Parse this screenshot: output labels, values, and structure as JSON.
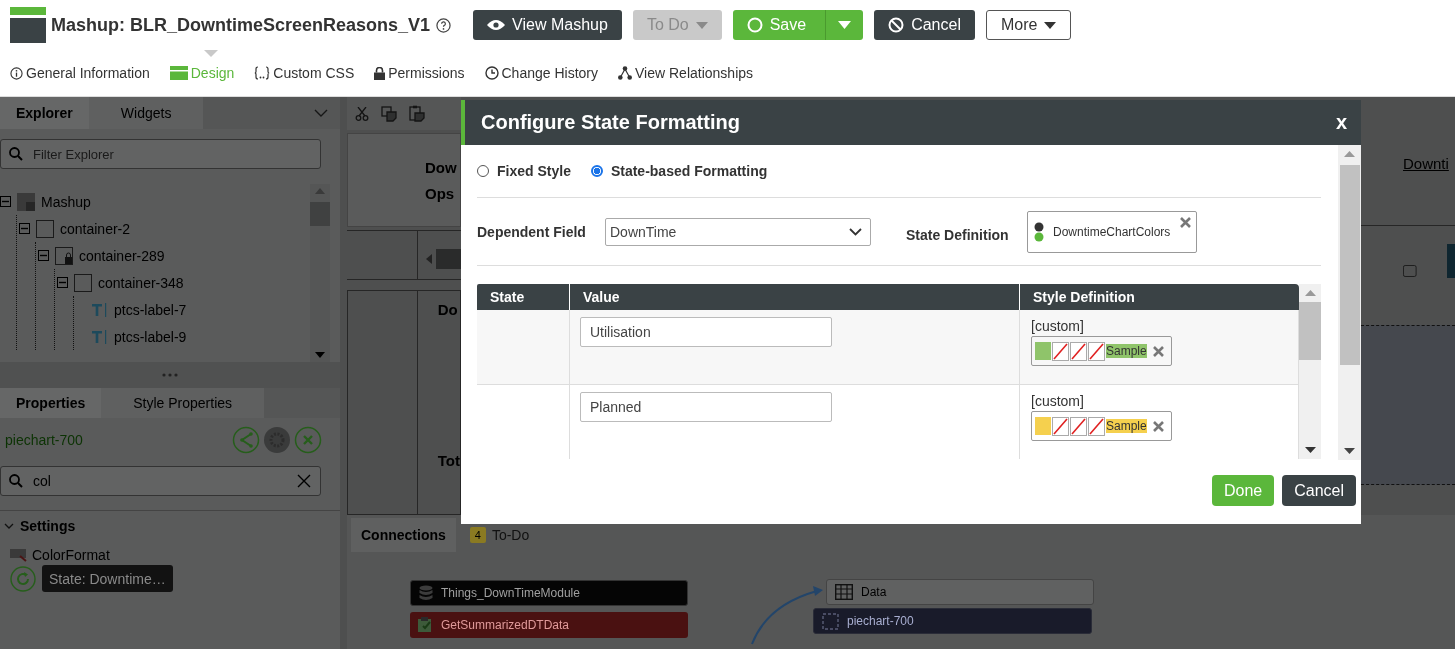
{
  "header": {
    "title": "Mashup: BLR_DowntimeScreenReasons_V1",
    "buttons": [
      {
        "label": "View Mashup",
        "kind": "view"
      },
      {
        "label": "To Do",
        "kind": "menu-disabled"
      },
      {
        "label": "Save",
        "kind": "save"
      },
      {
        "label": "Cancel",
        "kind": "cancel"
      },
      {
        "label": "More",
        "kind": "menu"
      }
    ]
  },
  "nav_tabs": [
    {
      "label": "General Information",
      "selected": false
    },
    {
      "label": "Design",
      "selected": true
    },
    {
      "label": "Custom CSS",
      "selected": false
    },
    {
      "label": "Permissions",
      "selected": false
    },
    {
      "label": "Change History",
      "selected": false
    },
    {
      "label": "View Relationships",
      "selected": false
    }
  ],
  "explorer": {
    "tabs": [
      {
        "label": "Explorer",
        "selected": true
      },
      {
        "label": "Widgets",
        "selected": false
      }
    ],
    "filter": {
      "placeholder": "Filter Explorer"
    },
    "tree": [
      {
        "label": "Mashup",
        "kind": "mashup",
        "expanded": true,
        "children": [
          {
            "label": "container-2",
            "kind": "container",
            "locked": false,
            "expanded": true,
            "children": [
              {
                "label": "container-289",
                "kind": "container",
                "locked": true,
                "expanded": true,
                "children": [
                  {
                    "label": "container-348",
                    "kind": "container",
                    "locked": false,
                    "expanded": true,
                    "children": [
                      {
                        "label": "ptcs-label-7",
                        "kind": "label"
                      },
                      {
                        "label": "ptcs-label-9",
                        "kind": "label"
                      }
                    ]
                  }
                ]
              }
            ]
          }
        ]
      }
    ]
  },
  "properties": {
    "tabs": [
      {
        "label": "Properties",
        "selected": true
      },
      {
        "label": "Style Properties",
        "selected": false
      }
    ],
    "widget": "piechart-700",
    "search": {
      "value": "col"
    },
    "section": {
      "label": "Settings",
      "expanded": true
    },
    "property": {
      "label": "ColorFormat",
      "value": "State: Downtime…"
    }
  },
  "canvas": {
    "header_lines": [
      "Dow",
      "Ops"
    ],
    "column_header": "Do",
    "total_label": "Tot",
    "link": "Downti"
  },
  "connections": {
    "tabs": [
      {
        "label": "Connections",
        "selected": true
      },
      {
        "label": "To-Do",
        "selected": false,
        "count": "4"
      }
    ],
    "nodes": [
      {
        "label": "Things_DownTimeModule",
        "kind": "data-source"
      },
      {
        "label": "Data",
        "kind": "data"
      },
      {
        "label": "GetSummarizedDTData",
        "kind": "service"
      },
      {
        "label": "piechart-700",
        "kind": "widget"
      }
    ]
  },
  "dialog": {
    "title": "Configure State Formatting",
    "close": "x",
    "modes": [
      {
        "label": "Fixed Style",
        "selected": false
      },
      {
        "label": "State-based Formatting",
        "selected": true
      }
    ],
    "dependent_field": {
      "label": "Dependent Field",
      "value": "DownTime"
    },
    "state_definition": {
      "label": "State Definition",
      "value": "DowntimeChartColors"
    },
    "table": {
      "columns": [
        "State",
        "Value",
        "Style Definition"
      ],
      "rows": [
        {
          "value": "Utilisation",
          "style": {
            "label": "[custom]",
            "color": "#8fc46a",
            "sample": "Sample"
          }
        },
        {
          "value": "Planned",
          "style": {
            "label": "[custom]",
            "color": "#f5d04e",
            "sample": "Sample"
          }
        }
      ]
    },
    "buttons": [
      {
        "label": "Done",
        "kind": "primary"
      },
      {
        "label": "Cancel",
        "kind": "secondary"
      }
    ]
  }
}
